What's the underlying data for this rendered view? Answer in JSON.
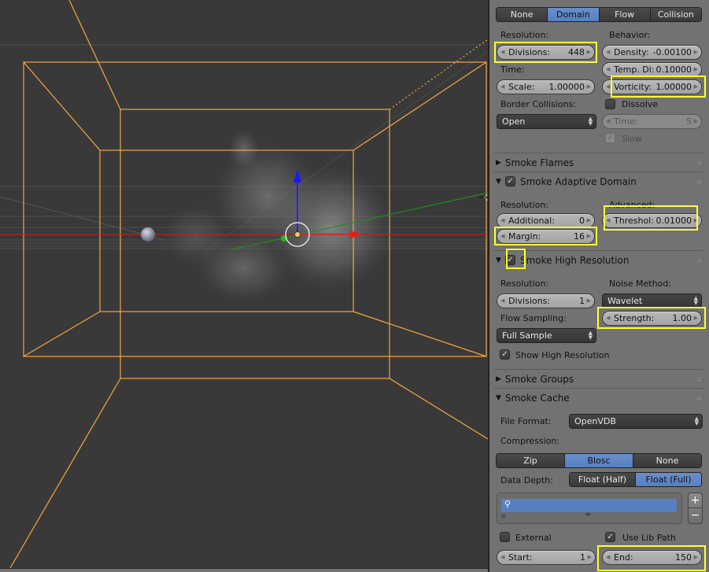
{
  "viewport": {
    "objects": [
      "smoke-domain-wireframe",
      "smoke-volume",
      "emitter-sphere",
      "3d-cursor",
      "transform-gizmo"
    ],
    "colors": {
      "background": "#393939",
      "wireframe": "#f5a742",
      "x_axis": "#cc2222",
      "y_axis": "#228822",
      "z_axis": "#1a1aff"
    }
  },
  "panel": {
    "type_tabs": [
      {
        "label": "None",
        "active": false
      },
      {
        "label": "Domain",
        "active": true
      },
      {
        "label": "Flow",
        "active": false
      },
      {
        "label": "Collision",
        "active": false
      }
    ],
    "domain": {
      "resolution_label": "Resolution:",
      "divisions": {
        "label": "Divisions:",
        "value": "448"
      },
      "time_label": "Time:",
      "scale": {
        "label": "Scale:",
        "value": "1.00000"
      },
      "border_collisions_label": "Border Collisions:",
      "border_collisions_value": "Open",
      "behavior_label": "Behavior:",
      "density": {
        "label": "Density:",
        "value": "-0.00100"
      },
      "temp_diff": {
        "label": "Temp. Di:",
        "value": "0.10000"
      },
      "vorticity": {
        "label": "Vorticity:",
        "value": "1.00000"
      },
      "dissolve": {
        "label": "Dissolve",
        "checked": false
      },
      "dissolve_time": {
        "label": "Time:",
        "value": "5"
      },
      "slow": {
        "label": "Slow",
        "checked": true
      }
    },
    "smoke_flames": {
      "title": "Smoke Flames",
      "expanded": false
    },
    "adaptive_domain": {
      "title": "Smoke Adaptive Domain",
      "expanded": true,
      "enabled": true,
      "resolution_label": "Resolution:",
      "additional": {
        "label": "Additional:",
        "value": "0"
      },
      "margin": {
        "label": "Margin:",
        "value": "16"
      },
      "advanced_label": "Advanced:",
      "threshold": {
        "label": "Threshol:",
        "value": "0.01000"
      }
    },
    "high_res": {
      "title": "Smoke High Resolution",
      "expanded": true,
      "enabled": true,
      "resolution_label": "Resolution:",
      "divisions": {
        "label": "Divisions:",
        "value": "1"
      },
      "flow_sampling_label": "Flow Sampling:",
      "flow_sampling_value": "Full Sample",
      "noise_method_label": "Noise Method:",
      "noise_method_value": "Wavelet",
      "strength": {
        "label": "Strength:",
        "value": "1.00"
      },
      "show_high_res": {
        "label": "Show High Resolution",
        "checked": true
      }
    },
    "smoke_groups": {
      "title": "Smoke Groups",
      "expanded": false
    },
    "cache": {
      "title": "Smoke Cache",
      "expanded": true,
      "file_format_label": "File Format:",
      "file_format_value": "OpenVDB",
      "compression_label": "Compression:",
      "compression_options": [
        {
          "label": "Zip",
          "active": false
        },
        {
          "label": "Blosc",
          "active": true
        },
        {
          "label": "None",
          "active": false
        }
      ],
      "data_depth_label": "Data Depth:",
      "data_depth_options": [
        {
          "label": "Float (Half)",
          "active": false
        },
        {
          "label": "Float (Full)",
          "active": true
        }
      ],
      "add_label": "+",
      "remove_label": "−",
      "external": {
        "label": "External",
        "checked": false
      },
      "use_lib_path": {
        "label": "Use Lib Path",
        "checked": true
      },
      "start": {
        "label": "Start:",
        "value": "1"
      },
      "end": {
        "label": "End:",
        "value": "150"
      }
    },
    "highlight_color": "#ffff33",
    "accent_color": "#5680c2"
  }
}
